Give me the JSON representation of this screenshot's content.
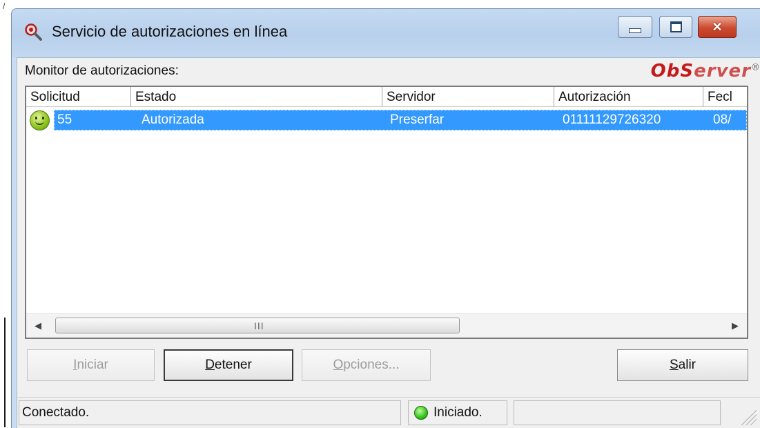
{
  "window": {
    "title": "Servicio de autorizaciones en línea",
    "controls": {
      "minimize": "minimize-icon",
      "maximize": "maximize-icon",
      "close": "close-icon"
    }
  },
  "stray_mark": "/",
  "monitor": {
    "label": "Monitor de autorizaciones:",
    "brand_part1": "ObS",
    "brand_part2": "erver",
    "brand_reg": "®"
  },
  "table": {
    "columns": [
      "Solicitud",
      "Estado",
      "Servidor",
      "Autorización",
      "Fecl"
    ],
    "rows": [
      {
        "icon": "smiley-icon",
        "solicitud": "55",
        "estado": "Autorizada",
        "servidor": "Preserfar",
        "autorizacion": "01111129726320",
        "fecha": "08/",
        "selected": true
      }
    ],
    "scrollbar": {
      "left_arrow": "◀",
      "right_arrow": "▶",
      "grip": "III"
    }
  },
  "buttons": {
    "iniciar": {
      "mnemonic": "I",
      "rest": "niciar",
      "enabled": false
    },
    "detener": {
      "mnemonic": "D",
      "rest": "etener",
      "enabled": true
    },
    "opciones": {
      "mnemonic": "O",
      "rest": "pciones...",
      "enabled": false
    },
    "salir": {
      "mnemonic": "S",
      "rest": "alir",
      "enabled": true
    }
  },
  "status": {
    "connection": "Conectado.",
    "state": "Iniciado.",
    "state_icon": "green-led-icon",
    "extra": ""
  },
  "colors": {
    "selection": "#3399ff",
    "brand": "#c41a1a",
    "close_button": "#cc4a2f",
    "window_frame": "#c9dcf1"
  }
}
